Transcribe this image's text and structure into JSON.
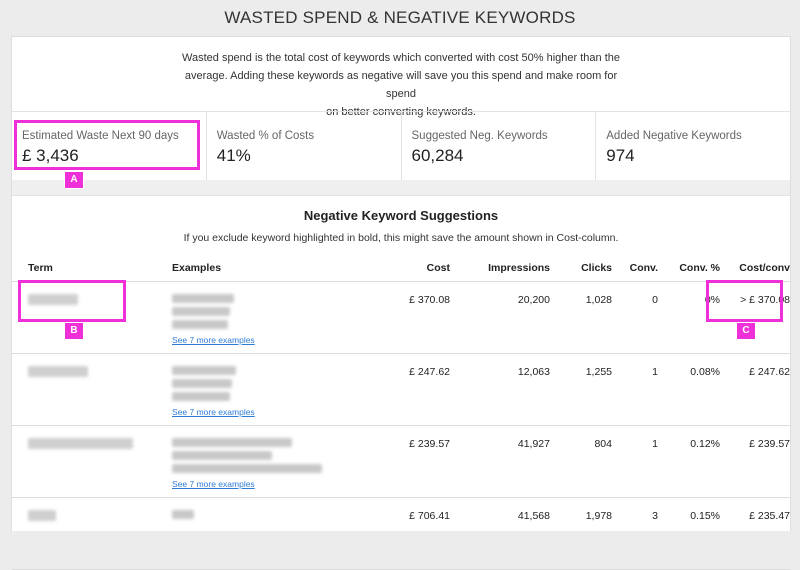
{
  "header": {
    "title": "WASTED SPEND & NEGATIVE KEYWORDS"
  },
  "description": {
    "line1": "Wasted spend is the total cost of keywords which converted with cost 50% higher than the",
    "line2": "average. Adding these keywords as negative will save you this spend and make room for spend",
    "line3": "on better converting keywords."
  },
  "stats": [
    {
      "label": "Estimated Waste Next 90 days",
      "value": "£ 3,436"
    },
    {
      "label": "Wasted % of Costs",
      "value": "41%"
    },
    {
      "label": "Suggested Neg. Keywords",
      "value": "60,284"
    },
    {
      "label": "Added Negative Keywords",
      "value": "974"
    }
  ],
  "suggestions": {
    "title": "Negative Keyword Suggestions",
    "subtitle": "If you exclude keyword highlighted in bold, this might save the amount shown in Cost-column.",
    "columns": [
      "Term",
      "Examples",
      "Cost",
      "Impressions",
      "Clicks",
      "Conv.",
      "Conv. %",
      "Cost/conv"
    ],
    "see_more": "See 7 more examples",
    "rows": [
      {
        "cost": "£ 370.08",
        "impressions": "20,200",
        "clicks": "1,028",
        "conv": "0",
        "conv_pct": "0%",
        "cost_conv": "> £ 370.08"
      },
      {
        "cost": "£ 247.62",
        "impressions": "12,063",
        "clicks": "1,255",
        "conv": "1",
        "conv_pct": "0.08%",
        "cost_conv": "£ 247.62"
      },
      {
        "cost": "£ 239.57",
        "impressions": "41,927",
        "clicks": "804",
        "conv": "1",
        "conv_pct": "0.12%",
        "cost_conv": "£ 239.57"
      },
      {
        "cost": "£ 706.41",
        "impressions": "41,568",
        "clicks": "1,978",
        "conv": "3",
        "conv_pct": "0.15%",
        "cost_conv": "£ 235.47"
      }
    ]
  },
  "annotations": {
    "a": "A",
    "b": "B",
    "c": "C"
  },
  "colors": {
    "annotation": "#ef2fd8",
    "link": "#2e7bd6"
  }
}
